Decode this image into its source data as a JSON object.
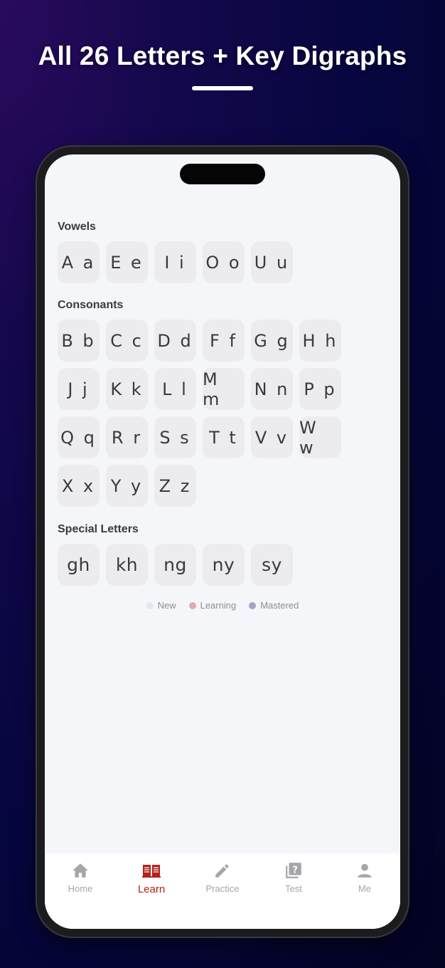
{
  "headline": "All 26 Letters + Key Digraphs",
  "sections": {
    "vowels": {
      "title": "Vowels",
      "letters": [
        "A a",
        "E e",
        "I i",
        "O o",
        "U u"
      ]
    },
    "consonants": {
      "title": "Consonants",
      "letters": [
        "B b",
        "C c",
        "D d",
        "F f",
        "G g",
        "H h",
        "J j",
        "K k",
        "L l",
        "M m",
        "N n",
        "P p",
        "Q q",
        "R r",
        "S s",
        "T t",
        "V v",
        "W w",
        "X x",
        "Y y",
        "Z z"
      ]
    },
    "special": {
      "title": "Special Letters",
      "letters": [
        "gh",
        "kh",
        "ng",
        "ny",
        "sy"
      ]
    }
  },
  "legend": [
    {
      "label": "New",
      "color": "#e6e6ee"
    },
    {
      "label": "Learning",
      "color": "#e3aab0"
    },
    {
      "label": "Mastered",
      "color": "#a3a4c8"
    }
  ],
  "tabbar": {
    "home": "Home",
    "learn": "Learn",
    "practice": "Practice",
    "test": "Test",
    "me": "Me",
    "active": "learn",
    "active_color": "#b3221c",
    "inactive_color": "#a5a5aa"
  }
}
